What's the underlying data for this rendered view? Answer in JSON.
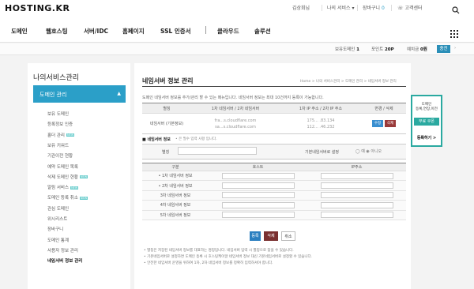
{
  "header": {
    "logo": "HOSTING.KR",
    "user": "김상회님",
    "my_service": "나의 서비스",
    "cart": "장바구니",
    "cart_count": "0",
    "support": "고객센터"
  },
  "gnb": [
    "도메인",
    "웹호스팅",
    "서버/IDC",
    "홈페이지",
    "SSL 인증서",
    "클라우드",
    "솔루션"
  ],
  "points": {
    "domains_label": "보유도메인",
    "domains_value": "1",
    "points_label": "포인트",
    "points_value": "20P",
    "deposit_label": "예치금",
    "deposit_value": "0원",
    "charge_label": "충전"
  },
  "lnb": {
    "title": "나의서비스관리",
    "active": "도메인 관리",
    "items": [
      {
        "label": "보유 도메인",
        "new": false
      },
      {
        "label": "등록정보 인증",
        "new": false
      },
      {
        "label": "홀더 관리",
        "new": true
      },
      {
        "label": "보유 키워드",
        "new": false
      },
      {
        "label": "기관이전 현황",
        "new": false
      },
      {
        "label": "예약 도메인 목록",
        "new": false
      },
      {
        "label": "삭제 도메인 현황",
        "new": true
      },
      {
        "label": "알림 서비스",
        "new": true
      },
      {
        "label": "도메인 등록 취소",
        "new": true
      },
      {
        "label": "관심 도메인",
        "new": false
      },
      {
        "label": "위시리스트",
        "new": false
      },
      {
        "label": "장바구니",
        "new": false
      },
      {
        "label": "도메인 통계",
        "new": false
      },
      {
        "label": "사용자 정보 관리",
        "new": false
      },
      {
        "label": "네임서버 정보 관리",
        "new": false
      }
    ],
    "new_badge": "NEW"
  },
  "main": {
    "title": "네임서버 정보 관리",
    "breadcrumb": "Home > 나의 서비스관리 > 도메인 관리 > 네임서버 정보 관리",
    "description": "도메인 네임서버 정보를 추가/관리 할 수 있는 메뉴입니다. 네임서버 정보는 최대 10건까지 등록이 가능합니다.",
    "table1": {
      "headers": [
        "별칭",
        "1차 네임서버 / 2차 네임서버",
        "1차 IP 주소 / 2차 IP 주소",
        "변경 / 삭제"
      ],
      "row": {
        "alias": "네임서버 (기본정보)",
        "ns1": "fra...s.cloudflare.com",
        "ns2": "sa...s.cloudflare.com",
        "ip1": "175...  .83.134",
        "ip2": "112...  .46.232",
        "edit": "수정",
        "delete": "삭제"
      }
    },
    "form": {
      "section_label": "네임서버 정보",
      "required_note": "• 은 필수 입력 사항 입니다.",
      "alias_label": "별칭",
      "default_label": "기본네임서버로 설정",
      "radio_yes": "예",
      "radio_no": "아니오"
    },
    "table2": {
      "headers": [
        "구분",
        "호스트",
        "IP주소"
      ],
      "rows": [
        "• 1차 네임서버 정보",
        "• 2차 네임서버 정보",
        "3차 네임서버 정보",
        "4차 네임서버 정보",
        "5차 네임서버 정보"
      ]
    },
    "buttons": {
      "register": "등록",
      "delete": "삭제",
      "cancel": "취소"
    },
    "notes": [
      "• 별칭은 저장된 네임서버 정보를 대표하는 명칭입니다. 네임서버 입력 시 별칭으로 찾을 수 있습니다.",
      "• 기본네임서버로 설정하면 도메인 등록 시 호스팅케이알 네임서버 정보 대신 기본네임서버로 설정할 수 있습니다.",
      "• 안전한 네임서버 운영을 위하여 1차, 2차 네임서버 정보를 정확히 입력하셔야 합니다."
    ]
  },
  "banner": {
    "line1": "도메인",
    "line2": "등록,연장,이전",
    "free": "무료 쿠폰",
    "register": "등록하기 >"
  },
  "colors": {
    "accent": "#2b9fc8",
    "banner": "#2aa9a0",
    "edit_btn": "#3a8fd0",
    "delete_btn": "#9a3a3a"
  }
}
